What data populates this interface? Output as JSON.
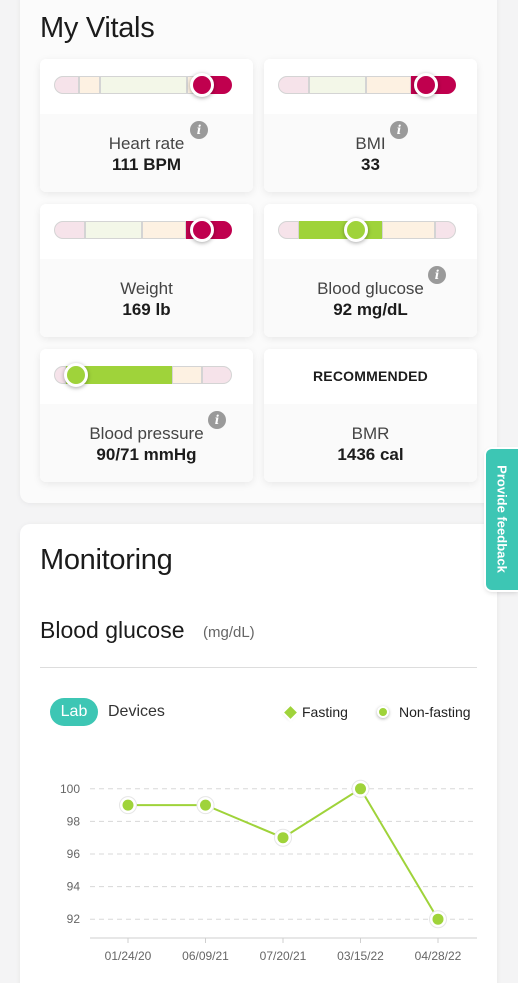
{
  "vitals": {
    "title": "My Vitals",
    "info_glyph": "i",
    "cards": [
      {
        "label": "Heart rate",
        "value": "111 BPM"
      },
      {
        "label": "BMI",
        "value": "33"
      },
      {
        "label": "Weight",
        "value": "169 lb"
      },
      {
        "label": "Blood glucose",
        "value": "92 mg/dL"
      },
      {
        "label": "Blood pressure",
        "value": "90/71 mmHg"
      },
      {
        "label": "BMR",
        "value": "1436 cal",
        "badge": "RECOMMENDED"
      }
    ],
    "colors": {
      "high": "#c0004e",
      "healthy": "#9fd33a",
      "low": "#f6e3ea",
      "neutral": "#f3f7e8",
      "warn": "#fdf1e2"
    }
  },
  "feedback": {
    "label": "Provide feedback"
  },
  "monitoring": {
    "title": "Monitoring",
    "metric_title": "Blood glucose",
    "metric_unit": "(mg/dL)",
    "tabs": {
      "active": "Lab",
      "other": "Devices"
    },
    "legend": {
      "fasting": "Fasting",
      "non_fasting": "Non-fasting"
    },
    "accent": "#3dc6b4"
  },
  "chart_data": {
    "type": "line",
    "categories": [
      "01/24/20",
      "06/09/21",
      "07/20/21",
      "03/15/22",
      "04/28/22"
    ],
    "series": [
      {
        "name": "Non-fasting",
        "values": [
          99,
          99,
          97,
          100,
          92
        ],
        "color": "#9fd33a"
      }
    ],
    "yticks": [
      92,
      94,
      96,
      98,
      100
    ],
    "ylim": [
      91,
      101
    ],
    "grid": true
  }
}
